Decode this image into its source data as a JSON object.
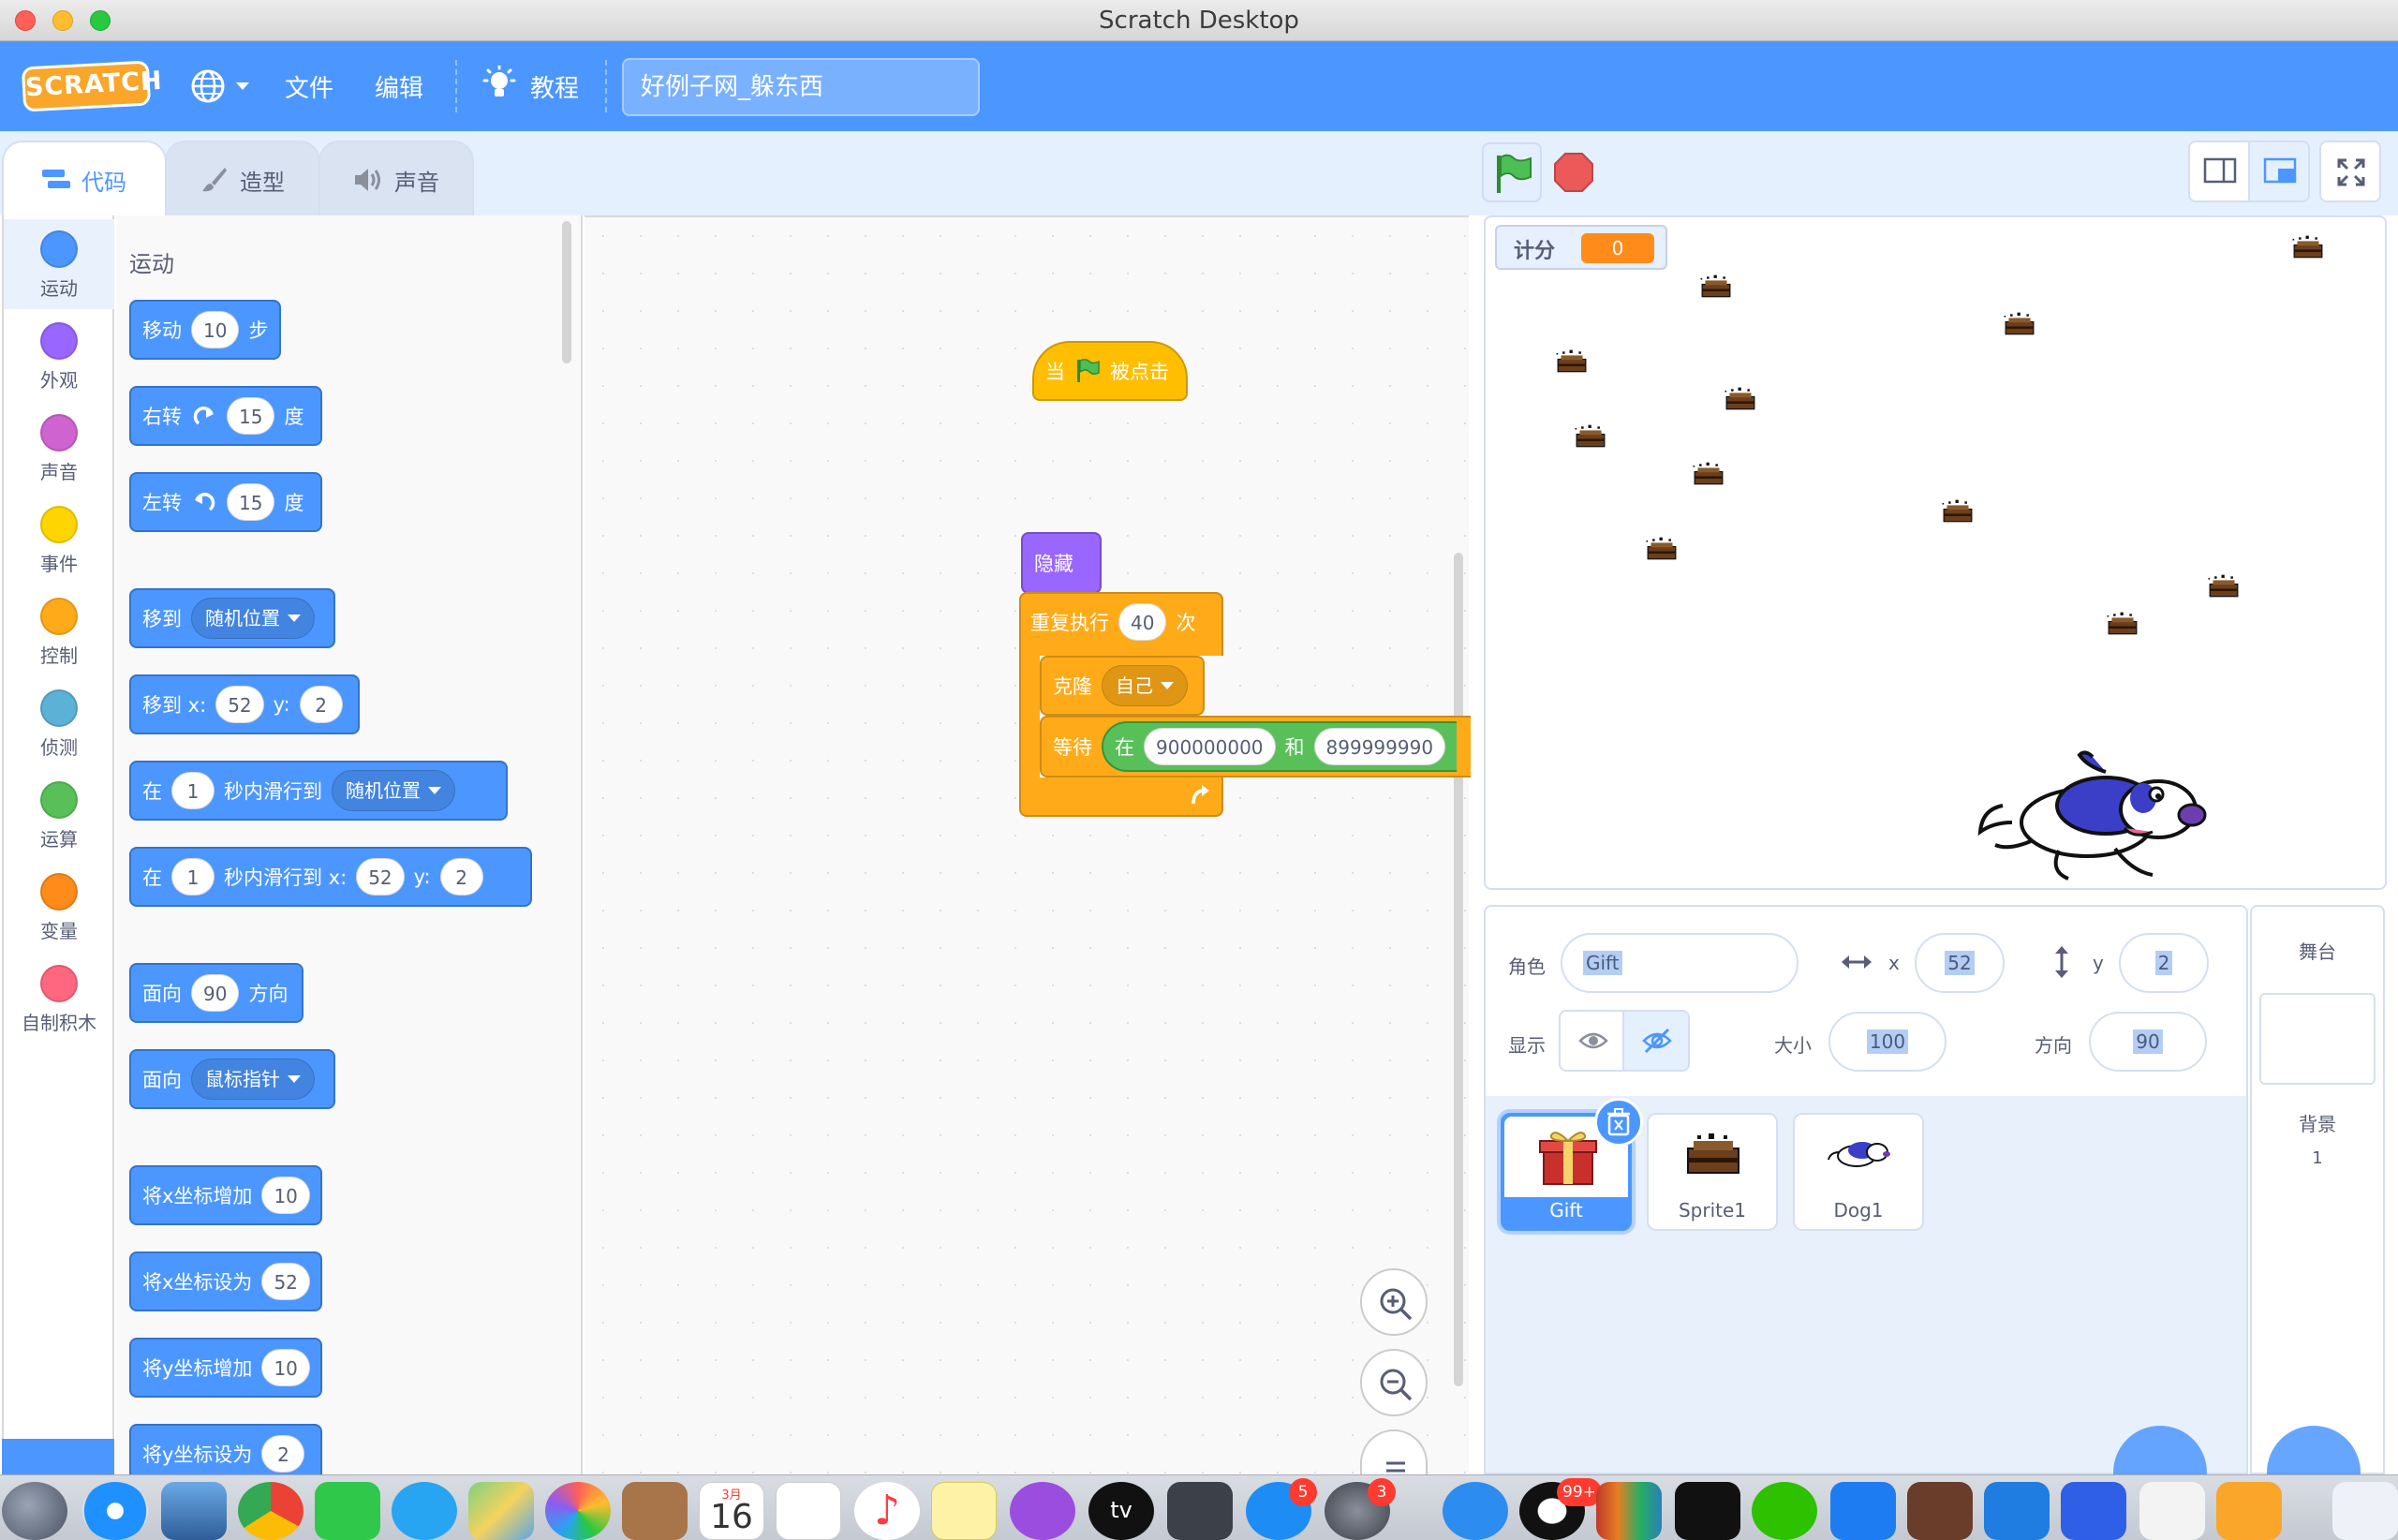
{
  "window": {
    "title": "Scratch Desktop"
  },
  "menubar": {
    "logo": "SCRATCH",
    "file": "文件",
    "edit": "编辑",
    "tutorials": "教程",
    "project_title": "好例子网_躲东西"
  },
  "tabs": {
    "code": "代码",
    "costumes": "造型",
    "sounds": "声音"
  },
  "categories": [
    {
      "label": "运动",
      "color": "#4c97ff"
    },
    {
      "label": "外观",
      "color": "#9966ff"
    },
    {
      "label": "声音",
      "color": "#cf63cf"
    },
    {
      "label": "事件",
      "color": "#ffd500"
    },
    {
      "label": "控制",
      "color": "#ffab19"
    },
    {
      "label": "侦测",
      "color": "#5cb1d6"
    },
    {
      "label": "运算",
      "color": "#59c059"
    },
    {
      "label": "变量",
      "color": "#ff8c1a"
    },
    {
      "label": "自制积木",
      "color": "#ff6680"
    }
  ],
  "palette": {
    "heading": "运动",
    "move": {
      "a": "移动",
      "v": "10",
      "b": "步"
    },
    "turn_right": {
      "a": "右转",
      "v": "15",
      "b": "度"
    },
    "turn_left": {
      "a": "左转",
      "v": "15",
      "b": "度"
    },
    "goto": {
      "a": "移到",
      "dd": "随机位置"
    },
    "goto_xy": {
      "a": "移到 x:",
      "x": "52",
      "b": "y:",
      "y": "2"
    },
    "glide": {
      "a": "在",
      "v": "1",
      "b": "秒内滑行到",
      "dd": "随机位置"
    },
    "glide_xy": {
      "a": "在",
      "v": "1",
      "b": "秒内滑行到 x:",
      "x": "52",
      "c": "y:",
      "y": "2"
    },
    "point_dir": {
      "a": "面向",
      "v": "90",
      "b": "方向"
    },
    "point_towards": {
      "a": "面向",
      "dd": "鼠标指针"
    },
    "change_x": {
      "a": "将x坐标增加",
      "v": "10"
    },
    "set_x": {
      "a": "将x坐标设为",
      "v": "52"
    },
    "change_y": {
      "a": "将y坐标增加",
      "v": "10"
    },
    "set_y": {
      "a": "将y坐标设为",
      "v": "2"
    }
  },
  "script": {
    "hat": {
      "a": "当",
      "b": "被点击"
    },
    "hide": "隐藏",
    "repeat": {
      "a": "重复执行",
      "v": "40",
      "b": "次"
    },
    "clone": {
      "a": "克隆",
      "dd": "自己"
    },
    "wait": {
      "a": "等待",
      "b": "在",
      "v1": "900000000",
      "c": "和",
      "v2": "899999990"
    }
  },
  "stage": {
    "monitor_label": "计分",
    "monitor_value": "0"
  },
  "sprite_info": {
    "sprite_label": "角色",
    "sprite_name": "Gift",
    "x_label": "x",
    "x_value": "52",
    "y_label": "y",
    "y_value": "2",
    "show_label": "显示",
    "size_label": "大小",
    "size_value": "100",
    "direction_label": "方向",
    "direction_value": "90"
  },
  "sprites": [
    {
      "name": "Gift",
      "selected": true
    },
    {
      "name": "Sprite1",
      "selected": false
    },
    {
      "name": "Dog1",
      "selected": false
    }
  ],
  "stage_panel": {
    "title": "舞台",
    "backdrops_label": "背景",
    "backdrops_count": "1"
  },
  "dock": {
    "calendar_month": "3月",
    "calendar_day": "16",
    "appstore_badge": "5",
    "prefs_badge": "3",
    "qq_badge": "99+",
    "tv_label": "tv"
  }
}
